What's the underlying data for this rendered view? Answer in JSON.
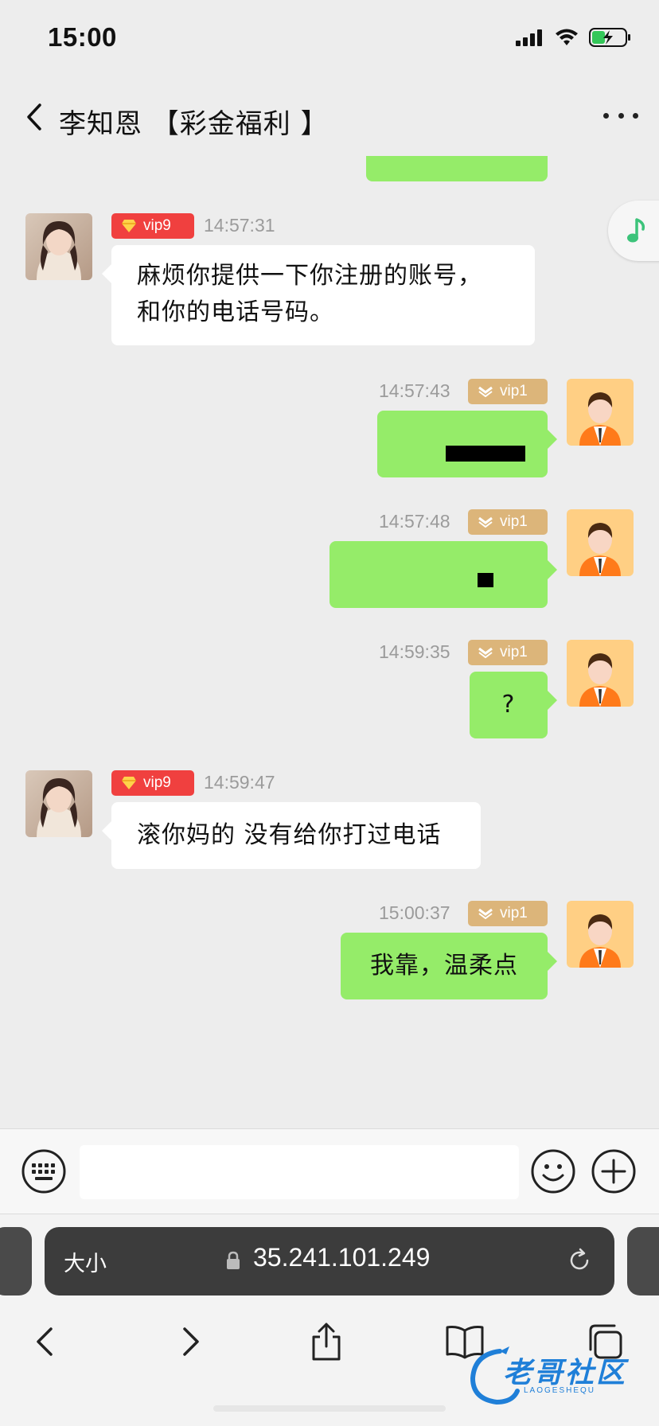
{
  "status_bar": {
    "time": "15:00"
  },
  "header": {
    "title": "李知恩 【彩金福利 】"
  },
  "messages": [
    {
      "side": "in",
      "badge": "vip9",
      "time": "14:57:31",
      "lines": [
        "麻烦你提供一下你注册的账号，",
        "和你的电话号码。"
      ]
    },
    {
      "side": "out",
      "badge": "vip1",
      "time": "14:57:43",
      "text": ""
    },
    {
      "side": "out",
      "badge": "vip1",
      "time": "14:57:48",
      "text": ""
    },
    {
      "side": "out",
      "badge": "vip1",
      "time": "14:59:35",
      "text": "?"
    },
    {
      "side": "in",
      "badge": "vip9",
      "time": "14:59:47",
      "text": "滚你妈的 没有给你打过电话"
    },
    {
      "side": "out",
      "badge": "vip1",
      "time": "15:00:37",
      "text": "我靠，温柔点"
    }
  ],
  "composer": {
    "value": ""
  },
  "browser": {
    "text_size_label": "大小",
    "url": "35.241.101.249"
  },
  "watermark": {
    "text": "老哥社区",
    "sub": "LAOGESHEQU"
  },
  "colors": {
    "incoming_bubble": "#ffffff",
    "outgoing_bubble": "#95ec69",
    "vip9_badge": "#f0403f",
    "vip1_badge": "#dcb57a",
    "background": "#ededed"
  },
  "icons": [
    "back-chevron-icon",
    "more-dots-icon",
    "music-note-icon",
    "keyboard-icon",
    "emoji-icon",
    "plus-icon",
    "lock-icon",
    "reload-icon",
    "share-icon",
    "bookmarks-icon",
    "tabs-icon"
  ]
}
